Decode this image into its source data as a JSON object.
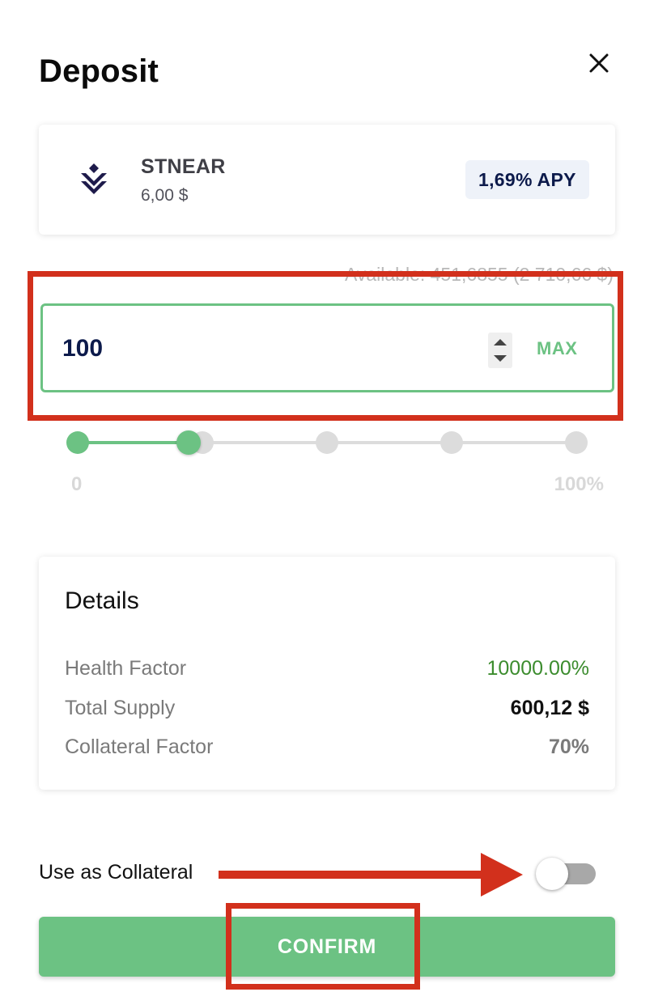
{
  "dialog": {
    "title": "Deposit",
    "close_icon": "close-icon"
  },
  "token": {
    "icon": "stnear-logo",
    "name": "STNEAR",
    "price": "6,00 $",
    "apy": "1,69% APY"
  },
  "amount": {
    "available": "Available: 451,6855 (2 710,66 $)",
    "value": "100",
    "max_label": "MAX"
  },
  "slider": {
    "min_label": "0",
    "max_label": "100%",
    "value_percent": 22,
    "steps": 5
  },
  "details": {
    "title": "Details",
    "rows": [
      {
        "label": "Health Factor",
        "value": "10000.00%"
      },
      {
        "label": "Total Supply",
        "value": "600,12 $"
      },
      {
        "label": "Collateral Factor",
        "value": "70%"
      }
    ]
  },
  "collateral": {
    "label": "Use as Collateral",
    "enabled": false
  },
  "confirm": {
    "label": "CONFIRM"
  },
  "colors": {
    "accent": "#6cc283",
    "health": "#3c8c2e",
    "annotation": "#d2301c",
    "navy": "#0c1a4b"
  }
}
